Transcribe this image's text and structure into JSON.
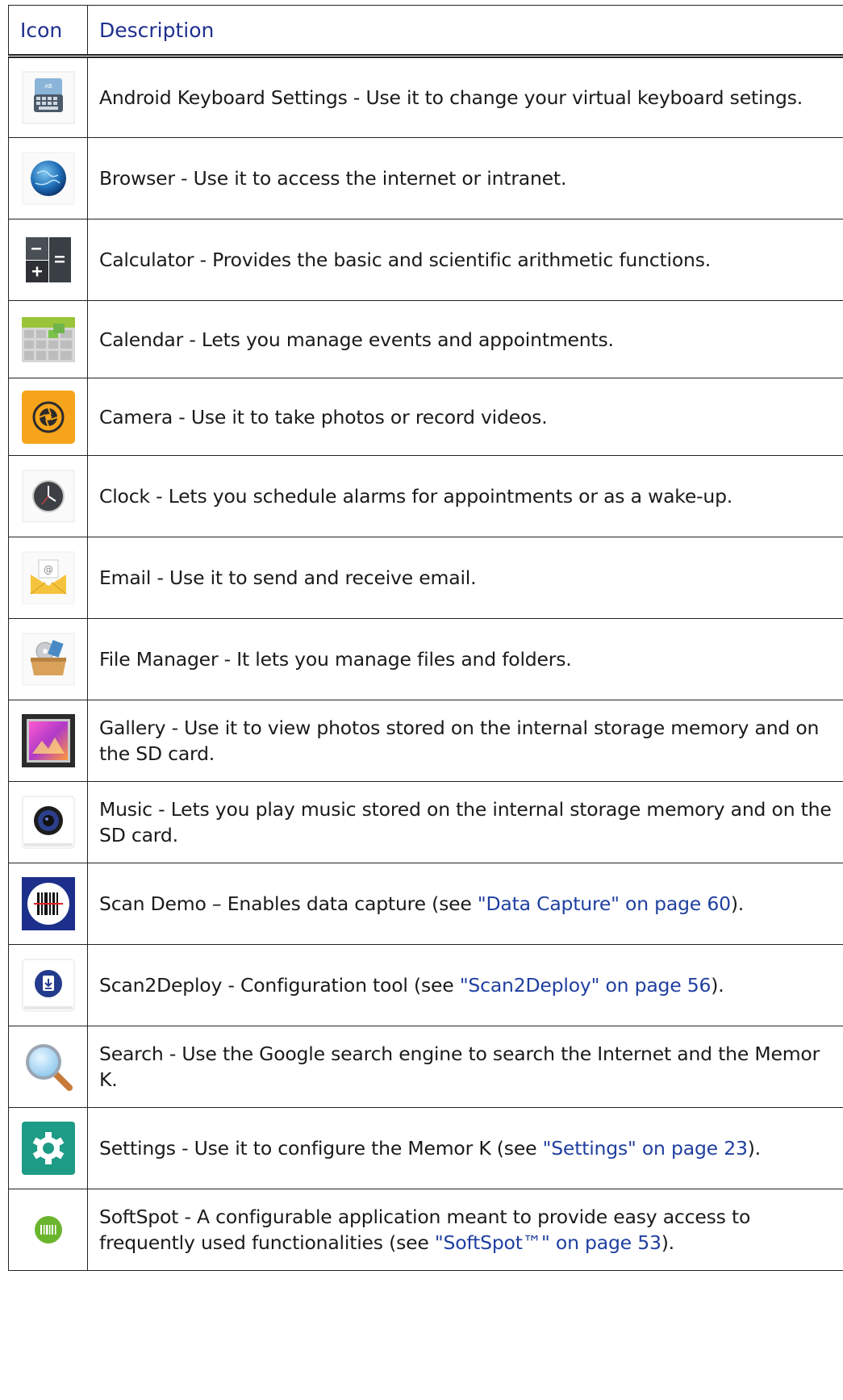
{
  "header": {
    "icon": "Icon",
    "description": "Description"
  },
  "rows": [
    {
      "icon": "keyboard-settings-icon",
      "name": "Android Keyboard Settings",
      "sep": " - ",
      "text": "Use it to change your virtual keyboard setings."
    },
    {
      "icon": "globe-icon",
      "name": "Browser",
      "sep": " - ",
      "text": "Use it to access the internet or intranet."
    },
    {
      "icon": "calculator-icon",
      "name": "Calculator",
      "sep": " - ",
      "text": "Provides the basic and scientific arithmetic functions."
    },
    {
      "icon": "calendar-icon",
      "name": "Calendar",
      "sep": " - ",
      "text": "Lets you manage events and appointments."
    },
    {
      "icon": "camera-icon",
      "name": "Camera",
      "sep": " - ",
      "text": "Use it to take photos or record videos."
    },
    {
      "icon": "clock-icon",
      "name": "Clock",
      "sep": " - ",
      "text": "Lets you schedule alarms for appointments or as a wake-up."
    },
    {
      "icon": "email-icon",
      "name": "Email",
      "sep": " - ",
      "text": "Use it to send and receive email."
    },
    {
      "icon": "file-manager-icon",
      "name": "File Manager",
      "sep": " - ",
      "text": "It lets you manage files and folders."
    },
    {
      "icon": "gallery-icon",
      "name": "Gallery",
      "sep": " - ",
      "text": "Use it to view photos stored on the internal storage memory and on the SD card."
    },
    {
      "icon": "music-speaker-icon",
      "name": "Music",
      "sep": " - ",
      "text": "Lets you play music stored on the internal storage memory and on the SD card."
    },
    {
      "icon": "barcode-scan-icon",
      "name": "Scan Demo",
      "sep": " – ",
      "text": "Enables data capture (see ",
      "link": "\"Data Capture\" on page 60",
      "after": ")."
    },
    {
      "icon": "scan2deploy-icon",
      "name": "Scan2Deploy",
      "sep": " - ",
      "text": "Configuration tool (see ",
      "link": "\"Scan2Deploy\" on page 56",
      "after": ")."
    },
    {
      "icon": "magnifier-icon",
      "name": "Search",
      "sep": " - ",
      "text": "Use the Google search engine to search the Internet and the Memor K."
    },
    {
      "icon": "gear-icon",
      "name": "Settings",
      "sep": " - ",
      "text": "Use it to configure the Memor K (see ",
      "link": "\"Settings\" on page 23",
      "after": ")."
    },
    {
      "icon": "softspot-barcode-icon",
      "name": "SoftSpot",
      "sep": " - ",
      "text": "A configurable application meant to provide easy access to frequently used functionalities (see ",
      "link": "\"SoftSpot™\" on page 53",
      "after": ")."
    }
  ]
}
